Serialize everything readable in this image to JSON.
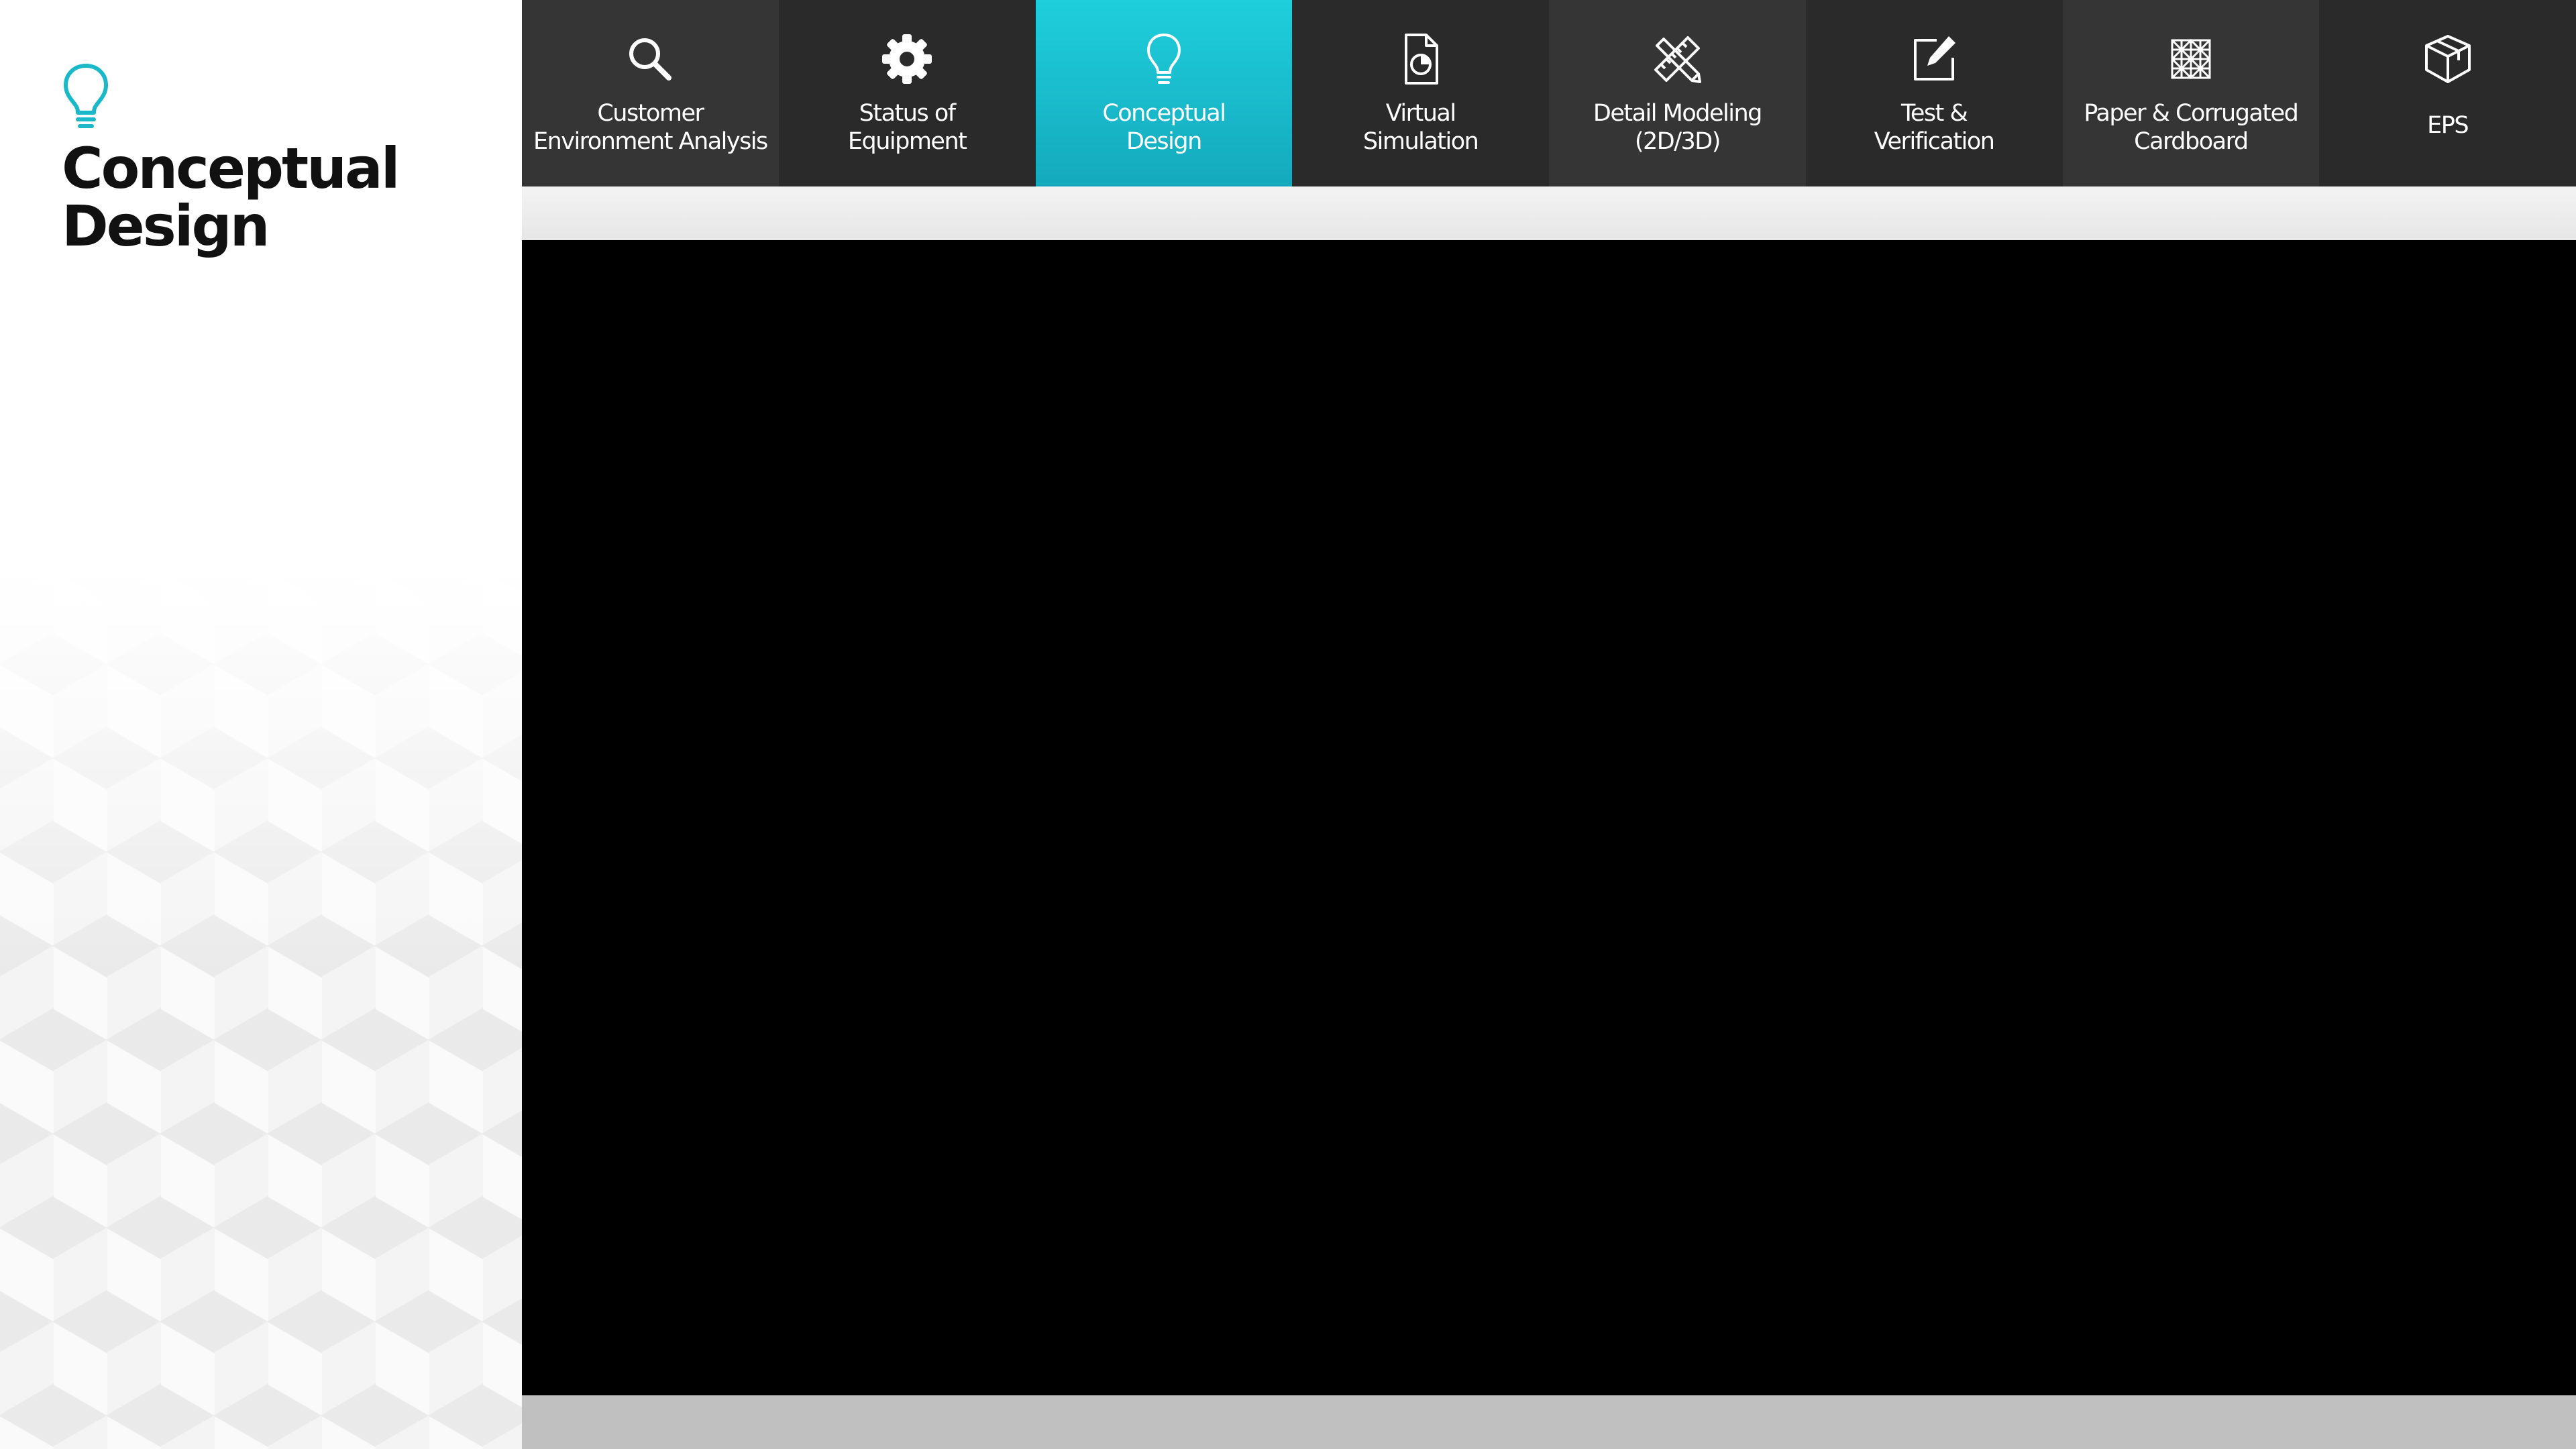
{
  "sidebar": {
    "title": "Conceptual Design",
    "icon": "lightbulb-icon",
    "accent_color": "#1ab9c9"
  },
  "nav": {
    "active_tab": "Conceptual Design",
    "tabs": [
      {
        "label": "Customer\nEnvironment Analysis",
        "icon": "search-icon"
      },
      {
        "label": "Status of\nEquipment",
        "icon": "gear-icon"
      },
      {
        "label": "Conceptual\nDesign",
        "icon": "lightbulb-icon"
      },
      {
        "label": "Virtual\nSimulation",
        "icon": "document-chart-icon"
      },
      {
        "label": "Detail Modeling\n(2D/3D)",
        "icon": "pencil-ruler-icon"
      },
      {
        "label": "Test &\nVerification",
        "icon": "edit-icon"
      },
      {
        "label": "Paper & Corrugated\nCardboard",
        "icon": "corrugated-grid-icon"
      },
      {
        "label": "EPS",
        "icon": "box-icon"
      }
    ]
  },
  "colors": {
    "nav_background": "#2c2c2c",
    "active_tab_top": "#1fcfdc",
    "active_tab_bottom": "#14a9bd",
    "content_background": "#000000"
  }
}
